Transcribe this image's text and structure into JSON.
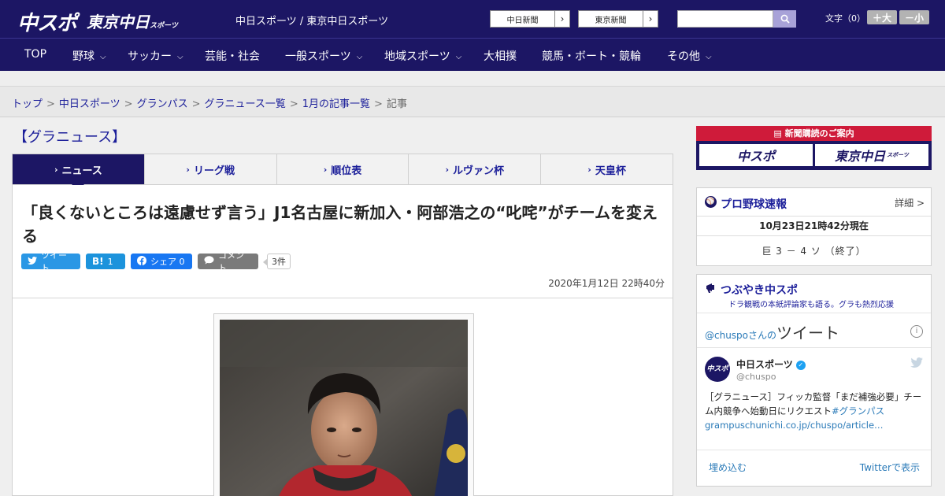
{
  "header": {
    "logo_chuspo": "中スポ",
    "logo_tokyo": "東京中日",
    "logo_tokyo_small": "スポーツ",
    "site_links": "中日スポーツ / 東京中日スポーツ",
    "paper_buttons": [
      "中日新聞",
      "東京新聞"
    ],
    "search_placeholder": "",
    "font_size_label": "文字（0）",
    "font_larger": "＋大",
    "font_smaller": "－小"
  },
  "nav": {
    "items": [
      "TOP",
      "野球",
      "サッカー",
      "芸能・社会",
      "一般スポーツ",
      "地域スポーツ",
      "大相撲",
      "競馬・ボート・競輪",
      "その他"
    ],
    "chevron": "⌵"
  },
  "breadcrumb": {
    "items": [
      "トップ",
      "中日スポーツ",
      "グランパス",
      "グラニュース一覧",
      "1月の記事一覧"
    ],
    "current": "記事",
    "separator": ">"
  },
  "section_title": "【グラニュース】",
  "tabs": [
    {
      "label": "ニュース",
      "active": true
    },
    {
      "label": "リーグ戦",
      "active": false
    },
    {
      "label": "順位表",
      "active": false
    },
    {
      "label": "ルヴァン杯",
      "active": false
    },
    {
      "label": "天皇杯",
      "active": false
    }
  ],
  "article": {
    "headline": "「良くないところは遠慮せず言う」J1名古屋に新加入・阿部浩之の“叱咤”がチームを変える",
    "share": {
      "tweet": "ツイート",
      "hatena_icon": "B!",
      "hatena_count": "1",
      "facebook": "シェア",
      "facebook_count": "0",
      "comment": "コメント",
      "comment_count": "3件"
    },
    "date": "2020年1月12日 22時40分"
  },
  "sidebar": {
    "ad": {
      "top": "新聞購読のご案内",
      "left_btn": "中スポ",
      "right_btn": "東京中日",
      "right_btn_small": "スポーツ"
    },
    "baseball": {
      "title": "プロ野球速報",
      "more": "詳細 >",
      "time": "10月23日21時42分現在",
      "score": "巨 3 － 4 ソ （終了）"
    },
    "tweets": {
      "title": "つぶやき中スポ",
      "subtitle": "ドラ観戦の本紙評論家も語る。グラも熱烈応援",
      "embed_handle_prefix": "@chuspoさんの",
      "embed_title": "ツイート",
      "info": "i",
      "account_name": "中日スポーツ",
      "account_handle": "@chuspo",
      "avatar_text": "中スポ",
      "body_text": "［グラニュース］フィッカ監督「まだ補強必要」チーム内競争へ始動日にリクエスト",
      "body_hashtag": "#グランパス",
      "body_link": "grampuschunichi.co.jp/chuspo/article…",
      "embed": "埋め込む",
      "view_on_twitter": "Twitterで表示"
    }
  },
  "colors": {
    "navy": "#1c1664",
    "link_blue": "#1c1f9a",
    "ad_red": "#cf1b3a"
  }
}
